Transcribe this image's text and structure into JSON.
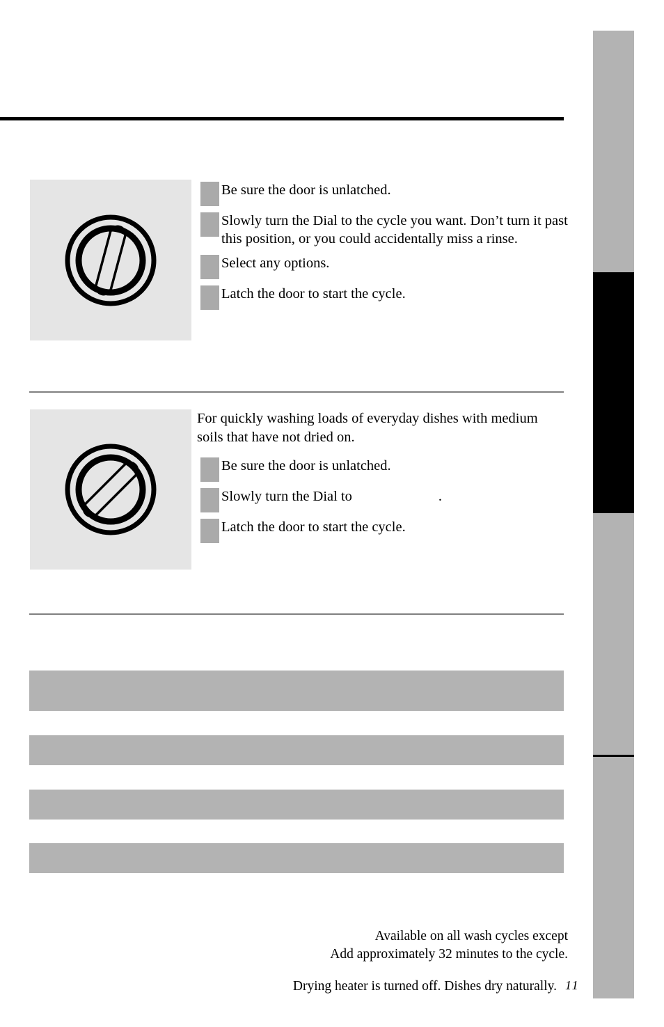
{
  "page": {
    "number": "11",
    "background_color": "#ffffff",
    "rule_color": "#000000",
    "separator_color": "#808080",
    "bar_color": "#b3b3b3",
    "bullet_color": "#aaaaaa",
    "figure_background": "#e5e5e5"
  },
  "tab_strip": {
    "segments": [
      {
        "name": "segment-top",
        "color": "#b3b3b3"
      },
      {
        "name": "segment-active",
        "color": "#000000"
      },
      {
        "name": "segment-third",
        "color": "#b3b3b3"
      },
      {
        "name": "segment-bottom",
        "color": "#b3b3b3"
      }
    ]
  },
  "sections": [
    {
      "figure": {
        "name": "dial-illustration-vertical",
        "pointer_rotation_degrees": 15,
        "pointer_filled": false
      },
      "intro": "",
      "steps": [
        {
          "text": "Be sure the door is unlatched."
        },
        {
          "text": "Slowly turn the Dial to the cycle you want. Don’t turn it past this position, or you could accidentally miss a rinse."
        },
        {
          "text": "Select any options."
        },
        {
          "text": "Latch the door to start the cycle."
        }
      ]
    },
    {
      "figure": {
        "name": "dial-illustration-diagonal",
        "pointer_rotation_degrees": 45,
        "pointer_filled": false
      },
      "intro": "For quickly washing loads of everyday dishes with medium soils that have not dried on.",
      "steps": [
        {
          "text": "Be sure the door is unlatched."
        },
        {
          "text_before": "Slowly turn the Dial to",
          "text_after": "."
        },
        {
          "text": "Latch the door to start the cycle."
        }
      ]
    }
  ],
  "bars": [
    {
      "label": ""
    },
    {
      "label": ""
    },
    {
      "label": ""
    },
    {
      "label": ""
    }
  ],
  "footnotes": {
    "line_1": "Available on all wash cycles except",
    "line_2": "Add approximately 32 minutes to the cycle.",
    "line_3": "Drying heater is turned off. Dishes dry naturally."
  }
}
